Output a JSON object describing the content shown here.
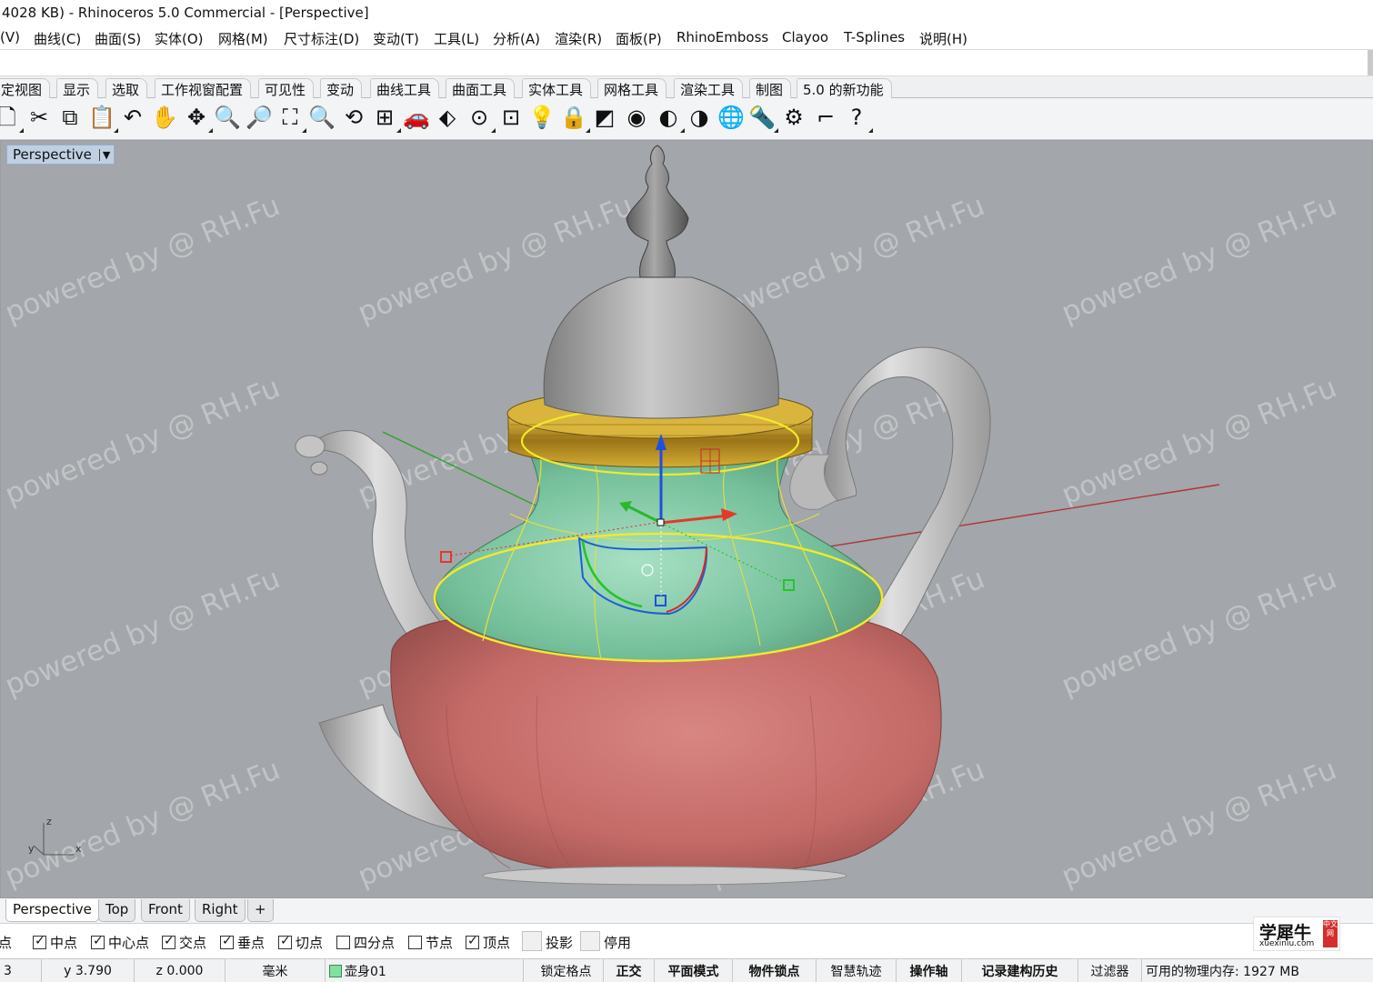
{
  "window": {
    "title": "4028 KB) - Rhinoceros 5.0 Commercial - [Perspective]"
  },
  "menu": [
    "(V)",
    "曲线(C)",
    "曲面(S)",
    "实体(O)",
    "网格(M)",
    "尺寸标注(D)",
    "变动(T)",
    "工具(L)",
    "分析(A)",
    "渲染(R)",
    "面板(P)",
    "RhinoEmboss",
    "Clayoo",
    "T-Splines",
    "说明(H)"
  ],
  "toolbar_tabs": [
    "定视图",
    "显示",
    "选取",
    "工作视窗配置",
    "可见性",
    "变动",
    "曲线工具",
    "曲面工具",
    "实体工具",
    "网格工具",
    "渲染工具",
    "制图",
    "5.0 的新功能"
  ],
  "toolbar_icons": [
    {
      "name": "new-icon",
      "glyph": "🗋"
    },
    {
      "name": "cut-icon",
      "glyph": "✂"
    },
    {
      "name": "copy-icon",
      "glyph": "⧉"
    },
    {
      "name": "paste-icon",
      "glyph": "📋"
    },
    {
      "name": "undo-icon",
      "glyph": "↶"
    },
    {
      "name": "pan-hand-icon",
      "glyph": "✋"
    },
    {
      "name": "rotate-view-icon",
      "glyph": "✥"
    },
    {
      "name": "zoom-icon",
      "glyph": "🔍"
    },
    {
      "name": "zoom-window-icon",
      "glyph": "🔎"
    },
    {
      "name": "zoom-extents-icon",
      "glyph": "⛶"
    },
    {
      "name": "zoom-selected-icon",
      "glyph": "🔍"
    },
    {
      "name": "undo-view-icon",
      "glyph": "⟲"
    },
    {
      "name": "four-viewports-icon",
      "glyph": "⊞"
    },
    {
      "name": "named-view-car-icon",
      "glyph": "🚗"
    },
    {
      "name": "cplane-icon",
      "glyph": "⬖"
    },
    {
      "name": "select-points-icon",
      "glyph": "⊙"
    },
    {
      "name": "properties-icon",
      "glyph": "⊡"
    },
    {
      "name": "light-bulb-icon",
      "glyph": "💡"
    },
    {
      "name": "lock-icon",
      "glyph": "🔒"
    },
    {
      "name": "layer-icon",
      "glyph": "◩"
    },
    {
      "name": "color-wheel-icon",
      "glyph": "◉"
    },
    {
      "name": "render-sphere-icon",
      "glyph": "◐"
    },
    {
      "name": "shaded-sphere-icon",
      "glyph": "◑"
    },
    {
      "name": "rendered-globe-icon",
      "glyph": "🌐"
    },
    {
      "name": "flashlight-icon",
      "glyph": "🔦"
    },
    {
      "name": "gear-options-icon",
      "glyph": "⚙"
    },
    {
      "name": "dimension-tool-icon",
      "glyph": "⌐"
    },
    {
      "name": "help-icon",
      "glyph": "?"
    }
  ],
  "viewport": {
    "title": "Perspective",
    "axis_labels": {
      "z": "z",
      "y": "y",
      "x": "x"
    },
    "watermark": "powered by @ RH.Fu"
  },
  "view_tabs": [
    "Perspective",
    "Top",
    "Front",
    "Right",
    "+"
  ],
  "osnaps": [
    {
      "label": "点",
      "checked": true
    },
    {
      "label": "中点",
      "checked": true
    },
    {
      "label": "中心点",
      "checked": true
    },
    {
      "label": "交点",
      "checked": true
    },
    {
      "label": "垂点",
      "checked": true
    },
    {
      "label": "切点",
      "checked": true
    },
    {
      "label": "四分点",
      "checked": false
    },
    {
      "label": "节点",
      "checked": false
    },
    {
      "label": "顶点",
      "checked": true
    },
    {
      "label": "投影",
      "checked": false
    },
    {
      "label": "停用",
      "checked": false
    }
  ],
  "logo": {
    "cn": "学犀牛",
    "en": "xuexiniu.com",
    "tag": "中文网"
  },
  "status": {
    "x": "3",
    "y": "y 3.790",
    "z": "z 0.000",
    "unit": "毫米",
    "layer": "壶身01",
    "items": [
      "锁定格点",
      "正交",
      "平面模式",
      "物件锁点",
      "智慧轨迹",
      "操作轴",
      "记录建构历史",
      "过滤器"
    ],
    "memory": "可用的物理内存: 1927 MB"
  },
  "colors": {
    "viewport_bg": "#a3a6aa",
    "selection_yellow": "#f2ea2a",
    "body_red": "#c96a66",
    "neck_green": "#7fc7a2",
    "metal_gray": "#bdbdbd",
    "gold_ring": "#c89c28"
  }
}
